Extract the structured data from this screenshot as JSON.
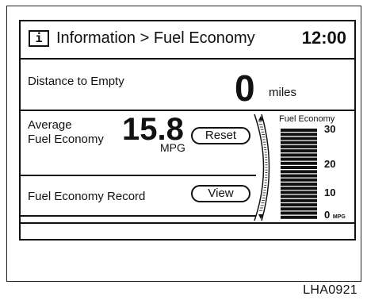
{
  "header": {
    "info_icon_glyph": "i",
    "title": "Information > Fuel Economy",
    "clock": "12:00"
  },
  "distance_to_empty": {
    "label": "Distance to Empty",
    "value": "0",
    "unit": "miles"
  },
  "average_fuel_economy": {
    "label_line1": "Average",
    "label_line2": "Fuel Economy",
    "value": "15.8",
    "unit": "MPG",
    "reset_label": "Reset"
  },
  "fuel_economy_record": {
    "label": "Fuel Economy Record",
    "view_label": "View"
  },
  "graph": {
    "title": "Fuel Economy",
    "y_ticks": [
      "30",
      "20",
      "10",
      "0"
    ],
    "y_unit": "MPG",
    "bar_count": 22,
    "max_value": 30
  },
  "figure_code": "LHA0921",
  "colors": {
    "ink": "#111111",
    "background": "#ffffff"
  }
}
